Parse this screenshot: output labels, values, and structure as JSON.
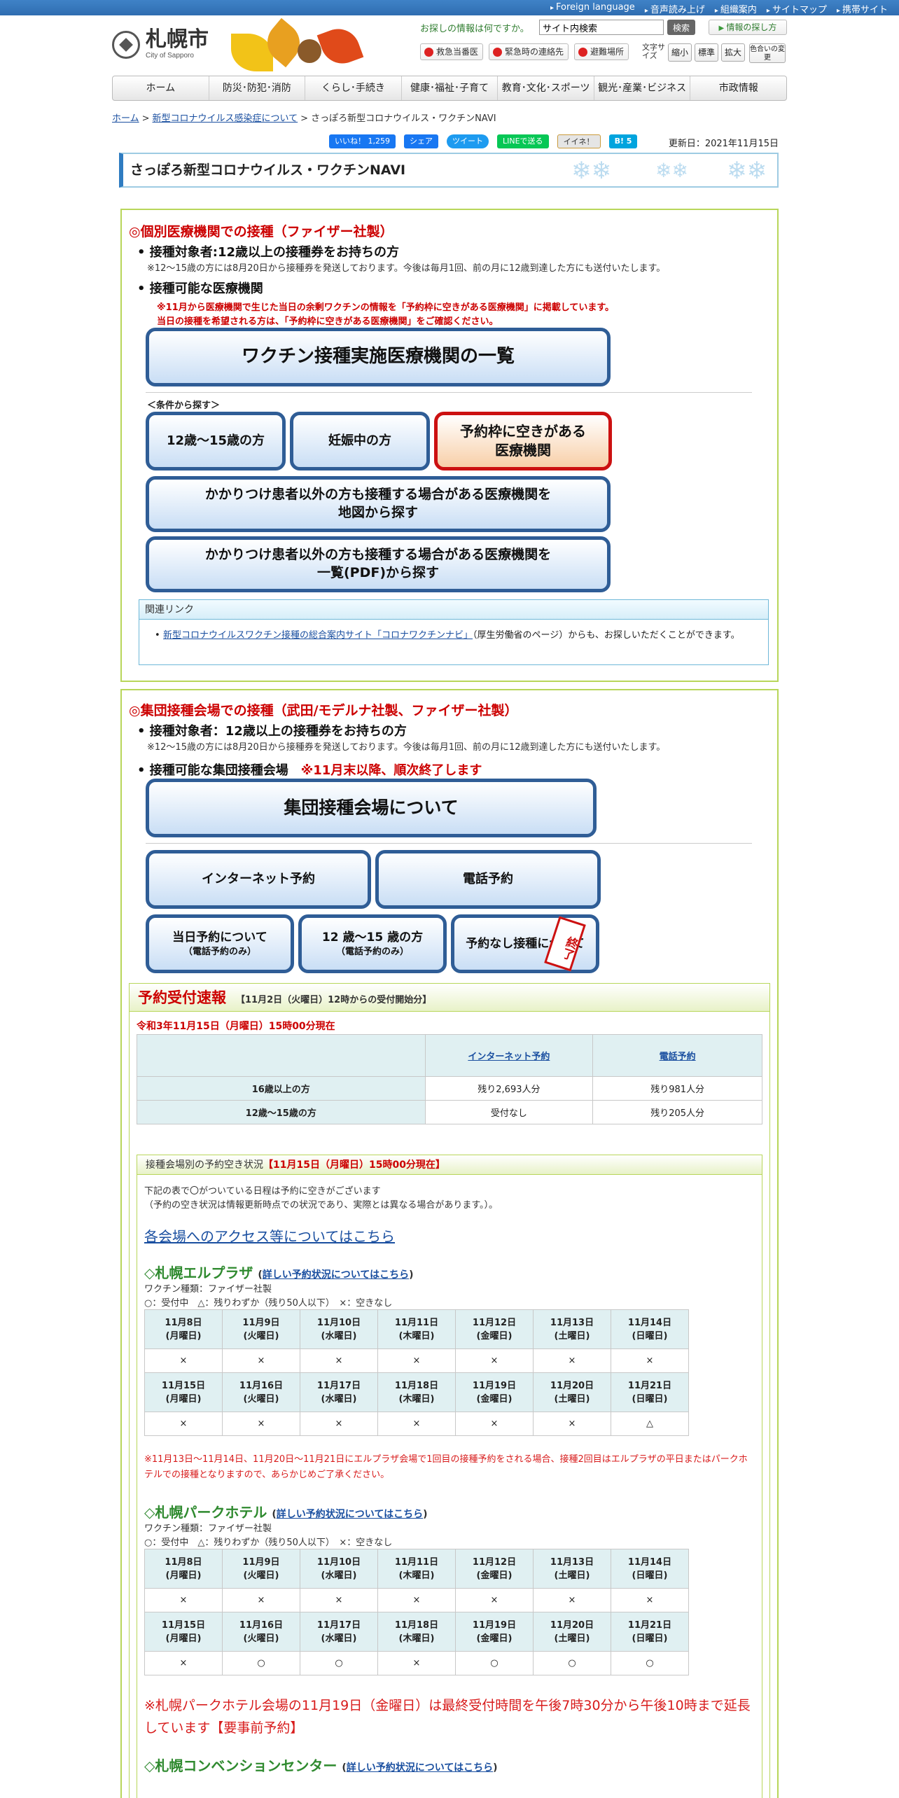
{
  "topbar": {
    "links": [
      "Foreign language",
      "音声読み上げ",
      "組織案内",
      "サイトマップ",
      "携帯サイト"
    ]
  },
  "header": {
    "logo_text": "札幌市",
    "logo_sub": "City of Sapporo",
    "search_label": "お探しの情報は何ですか。",
    "search_value": "サイト内検索",
    "search_button": "検索",
    "find_button": "情報の探し方",
    "emergency": [
      "救急当番医",
      "緊急時の連絡先",
      "避難場所"
    ],
    "font_size_label": "文字サイズ",
    "font_size_buttons": [
      "縮小",
      "標準",
      "拡大"
    ],
    "color_button": "色合いの変更"
  },
  "nav": [
    "ホーム",
    "防災･防犯･消防",
    "くらし･手続き",
    "健康･福祉･子育て",
    "教育･文化･スポーツ",
    "観光･産業･ビジネス",
    "市政情報"
  ],
  "breadcrumb": {
    "items": [
      "ホーム",
      "新型コロナウイルス感染症について"
    ],
    "current": "さっぽろ新型コロナウイルス・ワクチンNAVI"
  },
  "social": {
    "like": "いいね！ 1,259",
    "share": "シェア",
    "tweet": "ツイート",
    "line": "LINEで送る",
    "mixi": "イイネ！",
    "hatena": "B! 5"
  },
  "updated": "更新日：2021年11月15日",
  "page_title": "さっぽろ新型コロナウイルス・ワクチンNAVI",
  "section1": {
    "title": "◎個別医療機関での接種（ファイザー社製）",
    "target_head": "接種対象者:12歳以上の接種券をお持ちの方",
    "target_note": "※12～15歳の方には8月20日から接種券を発送しております。今後は毎月1回、前の月に12歳到達した方にも送付いたします。",
    "available_head": "接種可能な医療機関",
    "red_note1": "※11月から医療機関で生じた当日の余剰ワクチンの情報を「予約枠に空きがある医療機関」に掲載しています。",
    "red_note2": "当日の接種を希望される方は、「予約枠に空きがある医療機関」をご確認ください。",
    "list_button": "ワクチン接種実施医療機関の一覧",
    "condition_label": "＜条件から探す＞",
    "btn_12_15": "12歳～15歳の方",
    "btn_pregnant": "妊娠中の方",
    "btn_vacancy": "予約枠に空きがある\n医療機関",
    "btn_map": "かかりつけ患者以外の方も接種する場合がある医療機関を\n地図から探す",
    "btn_pdf": "かかりつけ患者以外の方も接種する場合がある医療機関を\n一覧(PDF)から探す",
    "related_head": "関連リンク",
    "related_link": "新型コロナウイルスワクチン接種の総合案内サイト「コロナワクチンナビ」",
    "related_text": "（厚生労働省のページ）からも、お探しいただくことができます。"
  },
  "section2": {
    "title": "◎集団接種会場での接種（武田/モデルナ社製、ファイザー社製）",
    "target_head": "接種対象者：12歳以上の接種券をお持ちの方",
    "target_note": "※12～15歳の方には8月20日から接種券を発送しております。今後は毎月1回、前の月に12歳到達した方にも送付いたします。",
    "available_head": "接種可能な集団接種会場",
    "available_red": "※11月末以降、順次終了します",
    "about_button": "集団接種会場について",
    "btn_internet": "インターネット予約",
    "btn_phone": "電話予約",
    "btn_sameday": "当日予約について",
    "btn_sameday_sub": "（電話予約のみ）",
    "btn_1215": "12 歳～15 歳の方",
    "btn_1215_sub": "（電話予約のみ）",
    "btn_noresv": "予約なし接種について",
    "ended_stamp": "終了"
  },
  "reservation": {
    "title": "予約受付速報",
    "subtitle": "【11月2日（火曜日）12時からの受付開始分】",
    "as_of": "令和3年11月15日（月曜日）15時00分現在",
    "col_internet": "インターネット予約",
    "col_phone": "電話予約",
    "rows": [
      {
        "label": "16歳以上の方",
        "internet": "残り2,693人分",
        "phone": "残り981人分"
      },
      {
        "label": "12歳～15歳の方",
        "internet": "受付なし",
        "phone": "残り205人分"
      }
    ]
  },
  "availability": {
    "head": "接種会場別の予約空き状況",
    "head_date": "【11月15日（月曜日）15時00分現在】",
    "intro1": "下記の表で〇がついている日程は予約に空きがございます",
    "intro2": "（予約の空き状況は情報更新時点での状況であり、実際とは異なる場合があります。）。",
    "access_link": "各会場へのアクセス等についてはこちら",
    "detail_link": "詳しい予約状況についてはこちら",
    "vaccine_type": "ワクチン種類：ファイザー社製",
    "legend": "○：受付中　△：残りわずか（残り50人以下）　×：空きなし",
    "week1": [
      "11月8日\n(月曜日)",
      "11月9日\n(火曜日)",
      "11月10日\n(水曜日)",
      "11月11日\n(木曜日)",
      "11月12日\n(金曜日)",
      "11月13日\n(土曜日)",
      "11月14日\n(日曜日)"
    ],
    "week2": [
      "11月15日\n(月曜日)",
      "11月16日\n(火曜日)",
      "11月17日\n(水曜日)",
      "11月18日\n(木曜日)",
      "11月19日\n(金曜日)",
      "11月20日\n(土曜日)",
      "11月21日\n(日曜日)"
    ],
    "venues": [
      {
        "name": "◇札幌エルプラザ",
        "w1": [
          "×",
          "×",
          "×",
          "×",
          "×",
          "×",
          "×"
        ],
        "w2": [
          "×",
          "×",
          "×",
          "×",
          "×",
          "×",
          "△"
        ],
        "note": "※11月13日～11月14日、11月20日～11月21日にエルプラザ会場で1回目の接種予約をされる場合、接種2回目はエルプラザの平日またはパークホテルでの接種となりますので、あらかじめご了承ください。"
      },
      {
        "name": "◇札幌パークホテル",
        "w1": [
          "×",
          "×",
          "×",
          "×",
          "×",
          "×",
          "×"
        ],
        "w2": [
          "×",
          "○",
          "○",
          "×",
          "○",
          "○",
          "○"
        ],
        "note": "※札幌パークホテル会場の11月19日（金曜日）は最終受付時間を午後7時30分から午後10時まで延長しています【要事前予約】"
      },
      {
        "name": "◇札幌コンベンションセンター"
      }
    ]
  }
}
